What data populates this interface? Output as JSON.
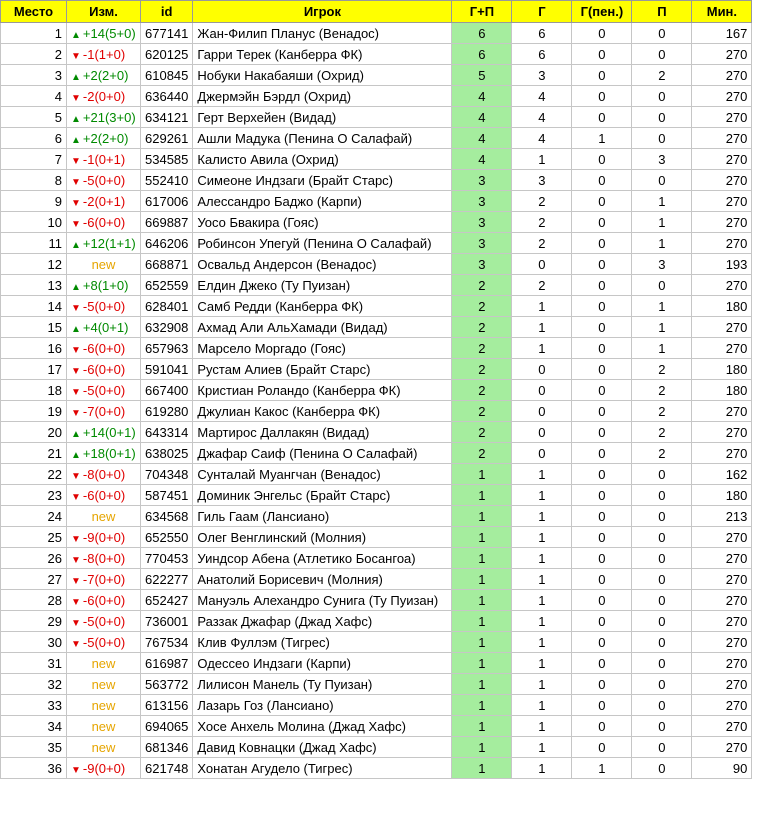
{
  "headers": {
    "rank": "Место",
    "change": "Изм.",
    "id": "id",
    "player": "Игрок",
    "gp": "Г+П",
    "g": "Г",
    "gpen": "Г(пен.)",
    "p": "П",
    "min": "Мин."
  },
  "colors": {
    "header_bg": "#ffff00",
    "gp_bg": "#a5ed9e",
    "up": "#008a00",
    "down": "#e00000",
    "new": "#e6a500"
  },
  "icons": {
    "up": "▲",
    "down": "▼"
  },
  "rows": [
    {
      "rank": "1",
      "dir": "up",
      "change": "+14(5+0)",
      "id": "677141",
      "player": "Жан-Филип Планус (Венадос)",
      "gp": "6",
      "g": "6",
      "gpen": "0",
      "p": "0",
      "min": "167"
    },
    {
      "rank": "2",
      "dir": "down",
      "change": "-1(1+0)",
      "id": "620125",
      "player": "Гарри Терек (Канберра ФК)",
      "gp": "6",
      "g": "6",
      "gpen": "0",
      "p": "0",
      "min": "270"
    },
    {
      "rank": "3",
      "dir": "up",
      "change": "+2(2+0)",
      "id": "610845",
      "player": "Нобуки Накабаяши (Охрид)",
      "gp": "5",
      "g": "3",
      "gpen": "0",
      "p": "2",
      "min": "270"
    },
    {
      "rank": "4",
      "dir": "down",
      "change": "-2(0+0)",
      "id": "636440",
      "player": "Джермэйн Бэрдл (Охрид)",
      "gp": "4",
      "g": "4",
      "gpen": "0",
      "p": "0",
      "min": "270"
    },
    {
      "rank": "5",
      "dir": "up",
      "change": "+21(3+0)",
      "id": "634121",
      "player": "Герт Верхейен (Видад)",
      "gp": "4",
      "g": "4",
      "gpen": "0",
      "p": "0",
      "min": "270"
    },
    {
      "rank": "6",
      "dir": "up",
      "change": "+2(2+0)",
      "id": "629261",
      "player": "Ашли Мадука (Пенина О Салафай)",
      "gp": "4",
      "g": "4",
      "gpen": "1",
      "p": "0",
      "min": "270"
    },
    {
      "rank": "7",
      "dir": "down",
      "change": "-1(0+1)",
      "id": "534585",
      "player": "Калисто Авила (Охрид)",
      "gp": "4",
      "g": "1",
      "gpen": "0",
      "p": "3",
      "min": "270"
    },
    {
      "rank": "8",
      "dir": "down",
      "change": "-5(0+0)",
      "id": "552410",
      "player": "Симеоне Индзаги (Брайт Старс)",
      "gp": "3",
      "g": "3",
      "gpen": "0",
      "p": "0",
      "min": "270"
    },
    {
      "rank": "9",
      "dir": "down",
      "change": "-2(0+1)",
      "id": "617006",
      "player": "Алессандро Баджо (Карпи)",
      "gp": "3",
      "g": "2",
      "gpen": "0",
      "p": "1",
      "min": "270"
    },
    {
      "rank": "10",
      "dir": "down",
      "change": "-6(0+0)",
      "id": "669887",
      "player": "Уосо Бвакира (Гояс)",
      "gp": "3",
      "g": "2",
      "gpen": "0",
      "p": "1",
      "min": "270"
    },
    {
      "rank": "11",
      "dir": "up",
      "change": "+12(1+1)",
      "id": "646206",
      "player": "Робинсон Упегуй (Пенина О Салафай)",
      "gp": "3",
      "g": "2",
      "gpen": "0",
      "p": "1",
      "min": "270"
    },
    {
      "rank": "12",
      "dir": "new",
      "change": "new",
      "id": "668871",
      "player": "Освальд Андерсон (Венадос)",
      "gp": "3",
      "g": "0",
      "gpen": "0",
      "p": "3",
      "min": "193"
    },
    {
      "rank": "13",
      "dir": "up",
      "change": "+8(1+0)",
      "id": "652559",
      "player": "Елдин Джеко (Ту Пуизан)",
      "gp": "2",
      "g": "2",
      "gpen": "0",
      "p": "0",
      "min": "270"
    },
    {
      "rank": "14",
      "dir": "down",
      "change": "-5(0+0)",
      "id": "628401",
      "player": "Самб Редди (Канберра ФК)",
      "gp": "2",
      "g": "1",
      "gpen": "0",
      "p": "1",
      "min": "180"
    },
    {
      "rank": "15",
      "dir": "up",
      "change": "+4(0+1)",
      "id": "632908",
      "player": "Ахмад Али АльХамади (Видад)",
      "gp": "2",
      "g": "1",
      "gpen": "0",
      "p": "1",
      "min": "270"
    },
    {
      "rank": "16",
      "dir": "down",
      "change": "-6(0+0)",
      "id": "657963",
      "player": "Марсело Моргадо (Гояс)",
      "gp": "2",
      "g": "1",
      "gpen": "0",
      "p": "1",
      "min": "270"
    },
    {
      "rank": "17",
      "dir": "down",
      "change": "-6(0+0)",
      "id": "591041",
      "player": "Рустам Алиев (Брайт Старс)",
      "gp": "2",
      "g": "0",
      "gpen": "0",
      "p": "2",
      "min": "180"
    },
    {
      "rank": "18",
      "dir": "down",
      "change": "-5(0+0)",
      "id": "667400",
      "player": "Кристиан Роландо (Канберра ФК)",
      "gp": "2",
      "g": "0",
      "gpen": "0",
      "p": "2",
      "min": "180"
    },
    {
      "rank": "19",
      "dir": "down",
      "change": "-7(0+0)",
      "id": "619280",
      "player": "Джулиан Какос (Канберра ФК)",
      "gp": "2",
      "g": "0",
      "gpen": "0",
      "p": "2",
      "min": "270"
    },
    {
      "rank": "20",
      "dir": "up",
      "change": "+14(0+1)",
      "id": "643314",
      "player": "Мартирос Даллакян (Видад)",
      "gp": "2",
      "g": "0",
      "gpen": "0",
      "p": "2",
      "min": "270"
    },
    {
      "rank": "21",
      "dir": "up",
      "change": "+18(0+1)",
      "id": "638025",
      "player": "Джафар Саиф (Пенина О Салафай)",
      "gp": "2",
      "g": "0",
      "gpen": "0",
      "p": "2",
      "min": "270"
    },
    {
      "rank": "22",
      "dir": "down",
      "change": "-8(0+0)",
      "id": "704348",
      "player": "Сунталай Муангчан (Венадос)",
      "gp": "1",
      "g": "1",
      "gpen": "0",
      "p": "0",
      "min": "162"
    },
    {
      "rank": "23",
      "dir": "down",
      "change": "-6(0+0)",
      "id": "587451",
      "player": "Доминик Энгельс (Брайт Старс)",
      "gp": "1",
      "g": "1",
      "gpen": "0",
      "p": "0",
      "min": "180"
    },
    {
      "rank": "24",
      "dir": "new",
      "change": "new",
      "id": "634568",
      "player": "Гиль Гаам (Лансиано)",
      "gp": "1",
      "g": "1",
      "gpen": "0",
      "p": "0",
      "min": "213"
    },
    {
      "rank": "25",
      "dir": "down",
      "change": "-9(0+0)",
      "id": "652550",
      "player": "Олег Венглинский (Молния)",
      "gp": "1",
      "g": "1",
      "gpen": "0",
      "p": "0",
      "min": "270"
    },
    {
      "rank": "26",
      "dir": "down",
      "change": "-8(0+0)",
      "id": "770453",
      "player": "Уиндсор Абена (Атлетико Босангоа)",
      "gp": "1",
      "g": "1",
      "gpen": "0",
      "p": "0",
      "min": "270"
    },
    {
      "rank": "27",
      "dir": "down",
      "change": "-7(0+0)",
      "id": "622277",
      "player": "Анатолий Борисевич (Молния)",
      "gp": "1",
      "g": "1",
      "gpen": "0",
      "p": "0",
      "min": "270"
    },
    {
      "rank": "28",
      "dir": "down",
      "change": "-6(0+0)",
      "id": "652427",
      "player": "Мануэль Алехандро Сунига (Ту Пуизан)",
      "gp": "1",
      "g": "1",
      "gpen": "0",
      "p": "0",
      "min": "270"
    },
    {
      "rank": "29",
      "dir": "down",
      "change": "-5(0+0)",
      "id": "736001",
      "player": "Раззак Джафар (Джад Хафс)",
      "gp": "1",
      "g": "1",
      "gpen": "0",
      "p": "0",
      "min": "270"
    },
    {
      "rank": "30",
      "dir": "down",
      "change": "-5(0+0)",
      "id": "767534",
      "player": "Клив Фуллэм (Тигрес)",
      "gp": "1",
      "g": "1",
      "gpen": "0",
      "p": "0",
      "min": "270"
    },
    {
      "rank": "31",
      "dir": "new",
      "change": "new",
      "id": "616987",
      "player": "Одессео Индзаги (Карпи)",
      "gp": "1",
      "g": "1",
      "gpen": "0",
      "p": "0",
      "min": "270"
    },
    {
      "rank": "32",
      "dir": "new",
      "change": "new",
      "id": "563772",
      "player": "Лилисон Манель (Ту Пуизан)",
      "gp": "1",
      "g": "1",
      "gpen": "0",
      "p": "0",
      "min": "270"
    },
    {
      "rank": "33",
      "dir": "new",
      "change": "new",
      "id": "613156",
      "player": "Лазарь Гоз (Лансиано)",
      "gp": "1",
      "g": "1",
      "gpen": "0",
      "p": "0",
      "min": "270"
    },
    {
      "rank": "34",
      "dir": "new",
      "change": "new",
      "id": "694065",
      "player": "Хосе Анхель Молина (Джад Хафс)",
      "gp": "1",
      "g": "1",
      "gpen": "0",
      "p": "0",
      "min": "270"
    },
    {
      "rank": "35",
      "dir": "new",
      "change": "new",
      "id": "681346",
      "player": "Давид Ковнацки (Джад Хафс)",
      "gp": "1",
      "g": "1",
      "gpen": "0",
      "p": "0",
      "min": "270"
    },
    {
      "rank": "36",
      "dir": "down",
      "change": "-9(0+0)",
      "id": "621748",
      "player": "Хонатан Агудело (Тигрес)",
      "gp": "1",
      "g": "1",
      "gpen": "1",
      "p": "0",
      "min": "90"
    }
  ]
}
